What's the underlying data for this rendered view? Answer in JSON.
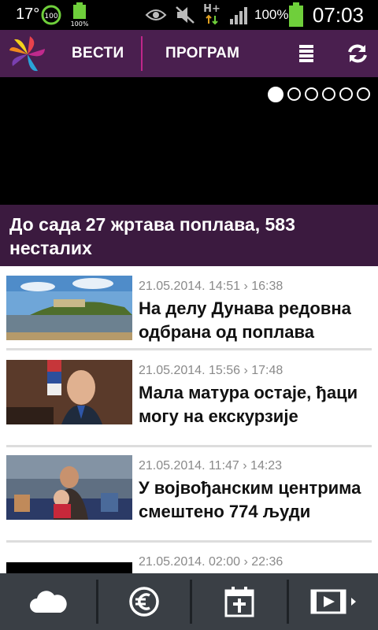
{
  "status_bar": {
    "temperature": "17°",
    "battery_small_label": "100%",
    "data_type": "H+",
    "battery_percent": "100%",
    "time": "07:03",
    "icons": [
      "temperature-widget",
      "cleaner-100-icon",
      "battery-small-icon",
      "eye-icon",
      "muted-icon",
      "data-hplus-icon",
      "signal-icon",
      "battery-icon"
    ]
  },
  "header": {
    "nav_vesti": "ВЕСТИ",
    "nav_program": "ПРОГРАМ",
    "colors": {
      "bar": "#4a1f4f",
      "divider": "#c0278a"
    }
  },
  "hero": {
    "caption": "До сада 27 жртава поплава, 583 несталих",
    "pager_count": 6,
    "pager_active": 1
  },
  "news": [
    {
      "meta": "21.05.2014. 14:51 › 16:38",
      "title": "На делу Дунава редовна одбрана од поплава"
    },
    {
      "meta": "21.05.2014. 15:56 › 17:48",
      "title": "Мала матура остаје, ђаци могу на екскурзије"
    },
    {
      "meta": "21.05.2014. 11:47 › 14:23",
      "title": "У војвођанским центрима смештено 774 људи"
    },
    {
      "meta": "21.05.2014. 02:00 › 22:36",
      "title": ""
    }
  ],
  "bottom_bar": {
    "buttons": [
      "weather-icon",
      "currency-euro-icon",
      "calendar-icon",
      "video-icon"
    ]
  }
}
